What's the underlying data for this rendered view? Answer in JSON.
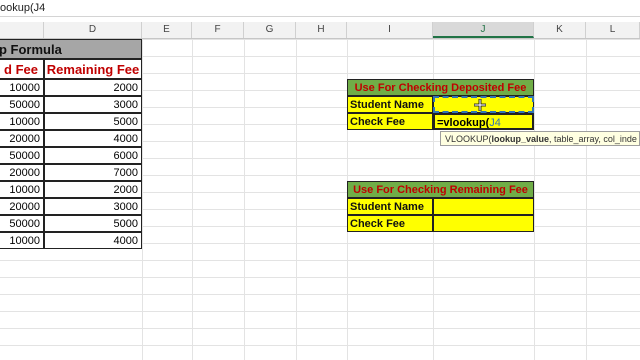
{
  "formula_bar": {
    "text": "ookup(J4"
  },
  "columns": [
    "D",
    "E",
    "F",
    "G",
    "H",
    "I",
    "J",
    "K",
    "L"
  ],
  "table": {
    "title": "p Formula",
    "headers": [
      "d Fee",
      "Remaining Fee"
    ],
    "rows": [
      [
        "10000",
        "2000"
      ],
      [
        "50000",
        "3000"
      ],
      [
        "10000",
        "5000"
      ],
      [
        "20000",
        "4000"
      ],
      [
        "50000",
        "6000"
      ],
      [
        "20000",
        "7000"
      ],
      [
        "10000",
        "2000"
      ],
      [
        "20000",
        "3000"
      ],
      [
        "50000",
        "5000"
      ],
      [
        "10000",
        "4000"
      ]
    ]
  },
  "deposited_box": {
    "title": "Use For Checking Deposited Fee",
    "name_label": "Student Name",
    "check_label": "Check Fee",
    "check_value": "=vlookup(",
    "check_ref": "J4"
  },
  "remaining_box": {
    "title": "Use For Checking Remaining Fee",
    "name_label": "Student Name",
    "check_label": "Check Fee"
  },
  "tooltip": {
    "fn": "VLOOKUP(",
    "arg1": "lookup_value",
    "rest": ", table_array, col_inde"
  },
  "colors": {
    "box_header": "#70ad47",
    "box_fill": "#ffff00",
    "header_text": "#c00000",
    "title_fill": "#a6a6a6"
  }
}
